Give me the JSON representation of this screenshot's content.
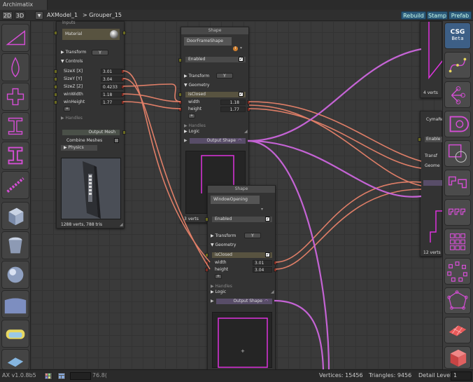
{
  "window": {
    "title": "Archimatix"
  },
  "toolbar": {
    "btn_2d": "2D",
    "btn_3d": "3D",
    "menu_arrow": "▼",
    "model_name": "AXModel_1",
    "breadcrumb": "> Grouper_15",
    "rebuild": "Rebuild",
    "stamp": "Stamp",
    "prefab": "Prefab"
  },
  "csg_button": {
    "line1": "CSG",
    "line2": "Beta"
  },
  "left_tools": [
    "triangle-mesh-icon",
    "lathe-icon",
    "cross-extrude-icon",
    "i-beam-icon",
    "i-beam-solid-icon",
    "stair-icon",
    "cube-icon",
    "cylinder-bin-icon",
    "sphere-icon",
    "curved-plane-icon",
    "rounded-rect-icon",
    "grid-repeater-icon"
  ],
  "right_tools": [
    "bezier-curve-icon",
    "branch-nodes-icon",
    "offset-shape-icon",
    "shape-merge-icon",
    "corner-shape-icon",
    "corner-array-icon",
    "grid-shapes-icon",
    "radial-array-icon",
    "polygon-nodes-icon",
    "plane-icon",
    "box-icon"
  ],
  "node_main": {
    "header_partial": "Inputs",
    "material_label": "Material",
    "transform_label": "Transform",
    "transform_axis": "Y",
    "controls_label": "Controls",
    "params": [
      {
        "name": "SizeX [X]",
        "value": "3.01"
      },
      {
        "name": "SizeY [Y]",
        "value": "3.04"
      },
      {
        "name": "SizeZ [Z]",
        "value": "0.4233"
      },
      {
        "name": "winWidth",
        "value": "1.18"
      },
      {
        "name": "winHeight",
        "value": "1.77"
      }
    ],
    "add_label": "+",
    "handles_label": "Handles",
    "output_mesh": "Output Mesh",
    "combine_meshes": "Combine Meshes",
    "physics": "Physics",
    "stats": "1288 verts, 788 tris"
  },
  "node_door": {
    "header": "Shape",
    "name": "DoorFrameShape",
    "info": "i",
    "enabled": "Enabled",
    "transform_label": "Transform",
    "transform_axis": "Y",
    "geometry_label": "Geometry",
    "isclosed": "isClosed",
    "params": [
      {
        "name": "width",
        "value": "1.18"
      },
      {
        "name": "height",
        "value": "1.77"
      }
    ],
    "add_label": "+",
    "handles_label": "Handles",
    "logic_label": "Logic",
    "output": "Output Shape",
    "stats": "3 verts"
  },
  "node_window": {
    "header": "Shape",
    "name": "WindowOpening",
    "enabled": "Enabled",
    "transform_label": "Transform",
    "transform_axis": "Y",
    "geometry_label": "Geometry",
    "isclosed": "isClosed",
    "params": [
      {
        "name": "width",
        "value": "3.01"
      },
      {
        "name": "height",
        "value": "3.04"
      }
    ],
    "add_label": "+",
    "handles_label": "Handles",
    "logic_label": "Logic",
    "output": "Output Shape"
  },
  "node_top_right": {
    "stats": "4 verts"
  },
  "node_cyma": {
    "name": "CymaRe",
    "enabled": "Enable",
    "transform_label": "Transf",
    "geometry_label": "Geome",
    "stats": "12 verts"
  },
  "status": {
    "version": "AX v1.0.8b5",
    "zoom": "76.8(",
    "vertices": "Vertices: 15456",
    "triangles": "Triangles: 9456",
    "detail_label": "Detail Level",
    "detail_value": "1"
  },
  "colors": {
    "wire_orange": "#e8826a",
    "wire_purple": "#cc66dd",
    "shape_magenta": "#dd33dd",
    "material_yellow": "#c8c040",
    "accent_blue": "#2b5a7a"
  }
}
